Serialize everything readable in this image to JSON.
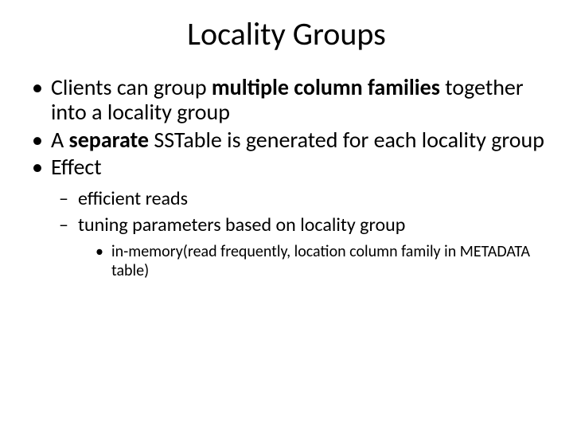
{
  "title": "Locality Groups",
  "b1_pre": "Clients can group ",
  "b1_bold": "multiple column families",
  "b1_post": " together into a locality group",
  "b2_pre": "A ",
  "b2_bold": "separate",
  "b2_post": " SSTable is generated for each locality group",
  "b3": "Effect",
  "s1": "efficient reads",
  "s2": "tuning parameters based on locality group",
  "t1": "in-memory(read frequently, location column family in METADATA table)"
}
